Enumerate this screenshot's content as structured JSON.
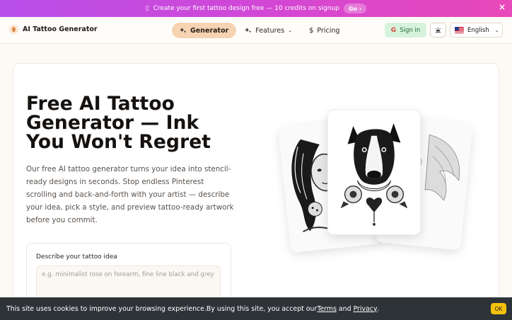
{
  "promo": {
    "text": "Create your first tattoo design free — 10 credits on signup",
    "go_label": "Go",
    "close_glyph": "×",
    "gift_icon": "gift-icon",
    "gradient": [
      "#b84fe9",
      "#e948b8"
    ]
  },
  "header": {
    "brand": "AI Tattoo Generator",
    "nav": [
      {
        "label": "Generator",
        "icon": "sparkles-icon",
        "active": true
      },
      {
        "label": "Features",
        "icon": "sparkles-icon",
        "dropdown": true
      },
      {
        "label": "Pricing",
        "icon": "dollar-icon"
      }
    ],
    "signin_label": "Sign in",
    "language": "English"
  },
  "hero": {
    "title": "Free AI Tattoo Generator — Ink You Won't Regret",
    "description": "Our free AI tattoo generator turns your idea into stencil-ready designs in seconds. Stop endless Pinterest scrolling and back-and-forth with your artist — describe your idea, pick a style, and preview tattoo-ready artwork before you commit."
  },
  "form": {
    "label": "Describe your tattoo idea",
    "placeholder": "e.g. minimalist rose on forearm, fine line black and grey",
    "value": ""
  },
  "cookie": {
    "text_before": "This site uses cookies to improve your browsing experience.By using this site, you accept our ",
    "terms": "Terms",
    "and": " and ",
    "privacy": "Privacy",
    "period": ".",
    "ok_label": "OK"
  },
  "colors": {
    "accent": "#f5d3b3",
    "signin_bg": "#d7f2dc",
    "cookie_bg": "#2e3338",
    "ok_bg": "#f4c20d"
  }
}
